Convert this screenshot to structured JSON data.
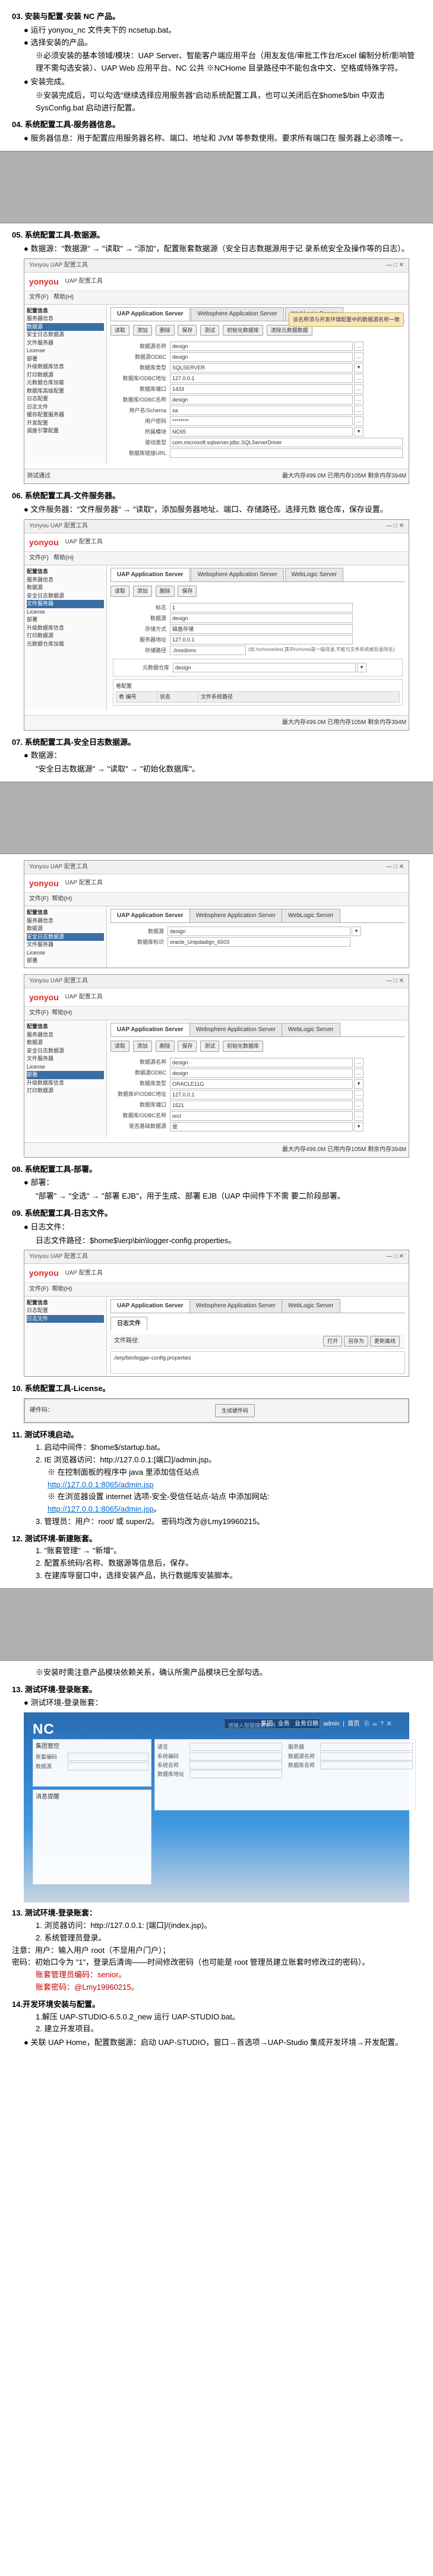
{
  "sections": {
    "s03": {
      "title": "03. 安装与配置-安装 NC 产品。",
      "bullet1": "运行 yonyou_nc 文件夹下的 ncsetup.bat。",
      "bullet2": "选择安装的产品。",
      "note1": "※必须安装的基本领域/模块：UAP Server、智能客户端应用平台（用友友信/审批工作台/Excel 编制分析/影响管理不需勾选安装）、UAP Web 应用平台、NC 公共 ※NCHome 目录路径中不能包含中文、空格或特殊字符。",
      "bullet3": "安装完成。",
      "note2": "※安装完成后，可以勾选\"继续选择应用服务器\"启动系统配置工具，也可以关闭后在$home$/bin 中双击 SysConfig.bat 启动进行配置。"
    },
    "s04": {
      "title": "04. 系统配置工具-服务器信息。",
      "bullet1": "服务器信息：用于配置应用服务器名称、端口、地址和 JVM 等参数使用。要求所有端口在 服务器上必须唯一。"
    },
    "s05": {
      "title": "05. 系统配置工具-数据源。",
      "bullet1": "数据源：\"数据源\" → \"读取\" → \"添加\"，配置账套数据源（安全日志数据源用于记 录系统安全及操作等的日志）。"
    },
    "tool": {
      "winTitle": "Yonyou UAP 配置工具",
      "menuFile": "文件(F)",
      "menuHelp": "帮助(H)",
      "treeTitle": "配置信息",
      "menuItems": [
        "服务器信息",
        "数据源",
        "安全日志数据源",
        "文件服务器",
        "License",
        "部署",
        "升级数据库信息",
        "打印数据源",
        "元数据仓库加载",
        "数据库高级配置",
        "日志配置",
        "日志文件",
        "缓存配置服务器",
        "开发配置",
        "调度引擎配置"
      ],
      "tabs": [
        "UAP Application Server",
        "Websphere Application Server",
        "WebLogic Server"
      ],
      "tbRead": "读取",
      "tbAdd": "添加",
      "tbDel": "删除",
      "tbSave": "保存",
      "tbTest": "测试",
      "tbInit": "初始化数据库",
      "tbClear": "清除元数据数据",
      "ds": {
        "l_name": "数据源名称",
        "v_name": "design",
        "l_odbc": "数据源ODBC",
        "v_odbc": "design",
        "l_type": "数据库类型",
        "v_type": "SQLSERVER",
        "l_ip": "数据库/ODBC地址",
        "v_ip": "127.0.0.1",
        "l_port": "数据库端口",
        "v_port": "1433",
        "l_sid": "数据库/ODBC名称",
        "v_sid": "design",
        "l_user": "用户名/Schema",
        "v_user": "sa",
        "l_pwd": "用户密码",
        "v_pwd": "********",
        "l_module": "所属模块",
        "v_module": "NC65",
        "l_driver": "驱动类型",
        "v_driver": "com.microsoft.sqlserver.jdbc.SQLServerDriver",
        "l_url": "数据库链接URL",
        "v_url": ""
      },
      "callout1": "该名称须与开发环境配置中的数据源名称一致",
      "foot_test": "测试通过",
      "foot_mem": "最大内存499.0M 已用内存105M 剩余内存394M"
    },
    "s06": {
      "title": "06. 系统配置工具-文件服务器。",
      "bullet1": "文件服务器：\"文件服务器\" → \"读取\"，添加服务器地址、端口、存储路径。选择元数 据仓库，保存设置。"
    },
    "fileServer": {
      "r1l": "标志",
      "r1v": "1",
      "r2l": "数据源",
      "r2v": "design",
      "r3l": "存储方式",
      "r3v": "磁盘存储",
      "r4l": "服务器地址",
      "r4v": "127.0.0.1",
      "r5l": "存储路径",
      "r5v": "./irssdionc",
      "note": "(如./nchome/test,其中nchome是一级目录,不能与文件系统根目录同名)",
      "metaLabel": "元数据仓库",
      "metaVal": "design",
      "volLabel": "卷配置",
      "volCol1": "卷 编号",
      "volCol2": "状态",
      "volCol3": "文件系统路径"
    },
    "s07": {
      "title": "07. 系统配置工具-安全日志数据源。",
      "bullet1": "数据源：",
      "sub1": "\"安全日志数据源\" → \"读取\" → \"初始化数据库\"。"
    },
    "s08": {
      "title": "08. 系统配置工具-部署。",
      "bullet1": "部署：",
      "sub1": "\"部署\" → \"全选\" → \"部署 EJB\"，用于生成、部署 EJB（UAP 中间件下不需 要二阶段部署。"
    },
    "deploy": {
      "dsLabel": "数据源",
      "dsVal": "design",
      "idLabel": "数据库标识",
      "idVal": "oracle_Unipdadign_6503",
      "f_name": "数据源名称",
      "fv_name": "design",
      "f_odbc": "数据源ODBC",
      "fv_odbc": "design",
      "f_type": "数据库类型",
      "fv_type": "ORACLE11G",
      "f_ip": "数据库IP/ODBC地址",
      "fv_ip": "127.0.0.1",
      "f_port": "数据库端口",
      "fv_port": "1521",
      "f_sid": "数据库/ODBC名称",
      "fv_sid": "orcl",
      "f_base": "是否基础数据源",
      "fv_base": "是"
    },
    "s09": {
      "title": "09. 系统配置工具-日志文件。",
      "bullet1": "日志文件：",
      "sub1": "日志文件路径：$home$\\ierp\\bin\\logger-config.properties。"
    },
    "logFile": {
      "tab1": "日志文件",
      "pathLabel": "文件路径:",
      "openBtn": "打开",
      "saveBtn": "另存为",
      "updBtn": "更新离线",
      "pathHdr": "./ierp/bin/logger-config.properties"
    },
    "s10": {
      "title": "10. 系统配置工具-License。",
      "licLabel": "硬件码：",
      "genBtn": "生成硬件码"
    },
    "s11": {
      "title": "11. 测试环境启动。",
      "i1": "1. 启动中间件：$home$/startup.bat。",
      "i2": "2. IE 浏览器访问：http://127.0.0.1:[端口]/admin.jsp。",
      "i2a": "※ 在控制面板的程序中 java 里添加信任站点",
      "i2a_link": "http://127.0.0.1:8065/admin.jsp",
      "i2b": "※ 在浏览器设置 internet 选项-安全-受信任站点-站点 中添加网站:",
      "i2b_link": "http://127.0.0.1:8065/admin.jsp",
      "i3": "3. 管理员：用户：root/ 或 super/2。 密码均改为@Lmy19960215。"
    },
    "s12": {
      "title": "12. 测试环境-新建账套。",
      "i1": "1. \"账套管理\" → \"新增\"。",
      "i2": "2. 配置系统码/名称、数据源等信息后，保存。",
      "i3": "3. 在建库导窗口中，选择安装产品，执行数据库安装脚本。",
      "note": "※安装时需注意产品模块依赖关系，确认所需产品模块已全部勾选。"
    },
    "s13": {
      "title": "13. 测试环境-登录账套。",
      "img_label": "测试环境-登录账套："
    },
    "nc": {
      "logo": "NC",
      "search_ph": "请输入智能搜索条件",
      "m1": "集团",
      "m2": "业务",
      "m3": "业务日期",
      "m4": "admin",
      "m5": "首页",
      "ico1": "⎘",
      "ico2": "☰",
      "ico3": "?",
      "ico4": "✕",
      "p1_title": "集团管控",
      "p1a": "账套编码",
      "p1b": "数据源",
      "p2a": "语言",
      "p2b": "系统编码",
      "p2c": "服务器",
      "p2d": "系统名称",
      "p2e": "数据源名称",
      "p2f": "数据库地址",
      "p2g": "数据库名称",
      "p3_title": "消息提醒"
    },
    "s13b": {
      "title": "13. 测试环境-登录账套：",
      "i1": "1. 浏览器访问：http://127.0.0.1: [端口]/(index.jsp)。",
      "i2": "2. 系统管理员登录。",
      "note1": "注意：用户：输入用户 root（不显用户门户）；",
      "note2": "密码：初始口令为 \"1\"，登录后清询——时间修改密码（也可能是 root 管理员建立账套时修改过的密码）。",
      "red1": "账套管理员编码：senior。",
      "red2": "账套密码：@Lmy19960215。"
    },
    "s14": {
      "title": "14.开发环境安装与配置。",
      "i1": "1.解压 UAP-STUDIO-6.5.0.2_new 运行 UAP-STUDIO.bat。",
      "i2": "2. 建立开发项目。",
      "b1": "关联 UAP Home，配置数据源：启动 UAP-STUDIO，窗口→首选项→UAP-Studio 集成开发环境→开发配置。"
    }
  }
}
